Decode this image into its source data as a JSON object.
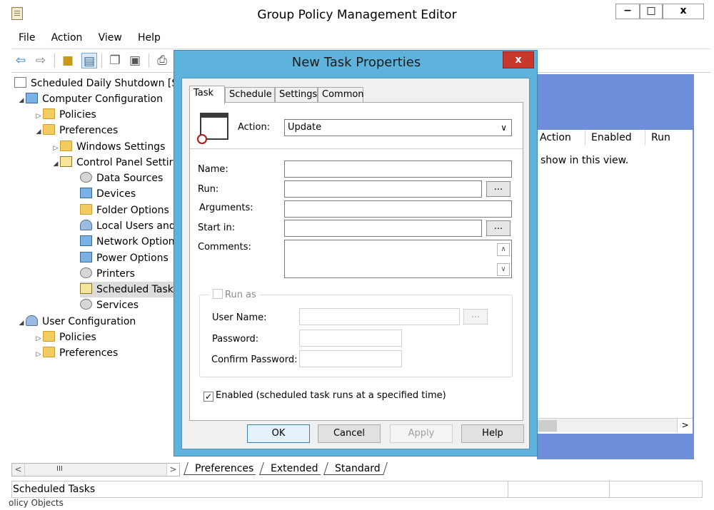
{
  "window": {
    "title": "Group Policy Management Editor",
    "min_label": "−",
    "max_label": "□",
    "close_label": "x"
  },
  "menu": [
    "File",
    "Action",
    "View",
    "Help"
  ],
  "toolbar": {
    "back_icon": "back-arrow-icon",
    "forward_icon": "forward-arrow-icon",
    "up_icon": "up-folder-icon",
    "tree_icon": "show-hide-tree-icon",
    "copy_icon": "copy-icon",
    "paste_icon": "paste-icon",
    "print_icon": "print-icon"
  },
  "tree": {
    "root": "Scheduled Daily Shutdown [SL",
    "computer_config": "Computer Configuration",
    "policies": "Policies",
    "preferences": "Preferences",
    "windows_settings": "Windows Settings",
    "control_panel": "Control Panel Settir",
    "items": [
      "Data Sources",
      "Devices",
      "Folder Options",
      "Local Users and",
      "Network Option",
      "Power Options",
      "Printers",
      "Scheduled Task",
      "Services"
    ],
    "user_config": "User Configuration",
    "user_policies": "Policies",
    "user_preferences": "Preferences"
  },
  "right_pane": {
    "columns": [
      "Action",
      "Enabled",
      "Run"
    ],
    "empty_message": "show in this view."
  },
  "bottom_tabs": [
    "Preferences",
    "Extended",
    "Standard"
  ],
  "status": {
    "text": "Scheduled Tasks",
    "fragment": "olicy Objects"
  },
  "dialog": {
    "title": "New Task Properties",
    "close_label": "x",
    "tabs": [
      "Task",
      "Schedule",
      "Settings",
      "Common"
    ],
    "action_label": "Action:",
    "action_value": "Update",
    "name_label": "Name:",
    "run_label": "Run:",
    "arguments_label": "Arguments:",
    "start_in_label": "Start in:",
    "comments_label": "Comments:",
    "browse_label": "...",
    "run_as_label": "Run as",
    "user_name_label": "User Name:",
    "password_label": "Password:",
    "confirm_password_label": "Confirm Password:",
    "enabled_label": "Enabled (scheduled task runs at a specified time)",
    "enabled_checked": true,
    "buttons": {
      "ok": "OK",
      "cancel": "Cancel",
      "apply": "Apply",
      "help": "Help"
    }
  }
}
